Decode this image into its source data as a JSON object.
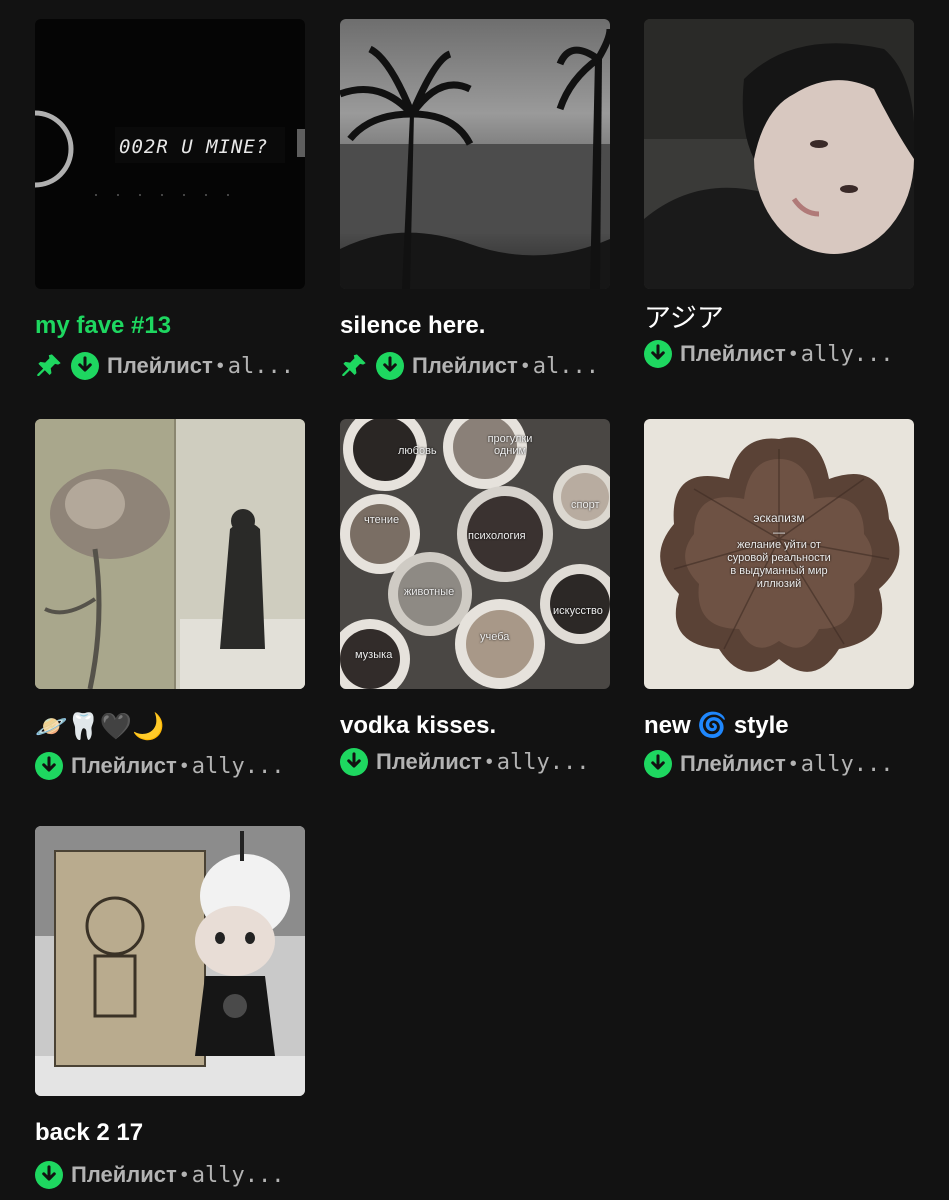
{
  "playlists": [
    {
      "title": "my fave #13",
      "type": "Плейлист",
      "separator": "•",
      "owner": "al...",
      "pinned": true,
      "downloaded": true,
      "cover_text": "002R U MINE?"
    },
    {
      "title": "silence here.",
      "type": "Плейлист",
      "separator": "•",
      "owner": "al...",
      "pinned": true,
      "downloaded": true
    },
    {
      "title": "アジア",
      "type": "Плейлист",
      "separator": "•",
      "owner": "ally...",
      "pinned": false,
      "downloaded": true
    },
    {
      "title": "🪐🦷🖤🌙",
      "type": "Плейлист",
      "separator": "•",
      "owner": "ally...",
      "pinned": false,
      "downloaded": true
    },
    {
      "title": "vodka kisses.",
      "type": "Плейлист",
      "separator": "•",
      "owner": "ally...",
      "pinned": false,
      "downloaded": true,
      "cover_labels": [
        "любовь",
        "прогулки одним",
        "чтение",
        "спорт",
        "психология",
        "животные",
        "искусство",
        "учеба",
        "музыка"
      ]
    },
    {
      "title": "new 🌀 style",
      "type": "Плейлист",
      "separator": "•",
      "owner": "ally...",
      "pinned": false,
      "downloaded": true,
      "cover_text_1": "эскапизм",
      "cover_text_2": "—",
      "cover_text_3": "желание уйти от суровой реальности в выдуманный мир иллюзий"
    },
    {
      "title": "back 2 17",
      "type": "Плейлист",
      "separator": "•",
      "owner": "ally...",
      "pinned": false,
      "downloaded": true
    }
  ],
  "colors": {
    "background": "#121212",
    "accent_green": "#1ed760",
    "secondary_text": "#b3b3b3"
  },
  "icons": {
    "pin": "pin-icon",
    "download": "download-icon"
  }
}
